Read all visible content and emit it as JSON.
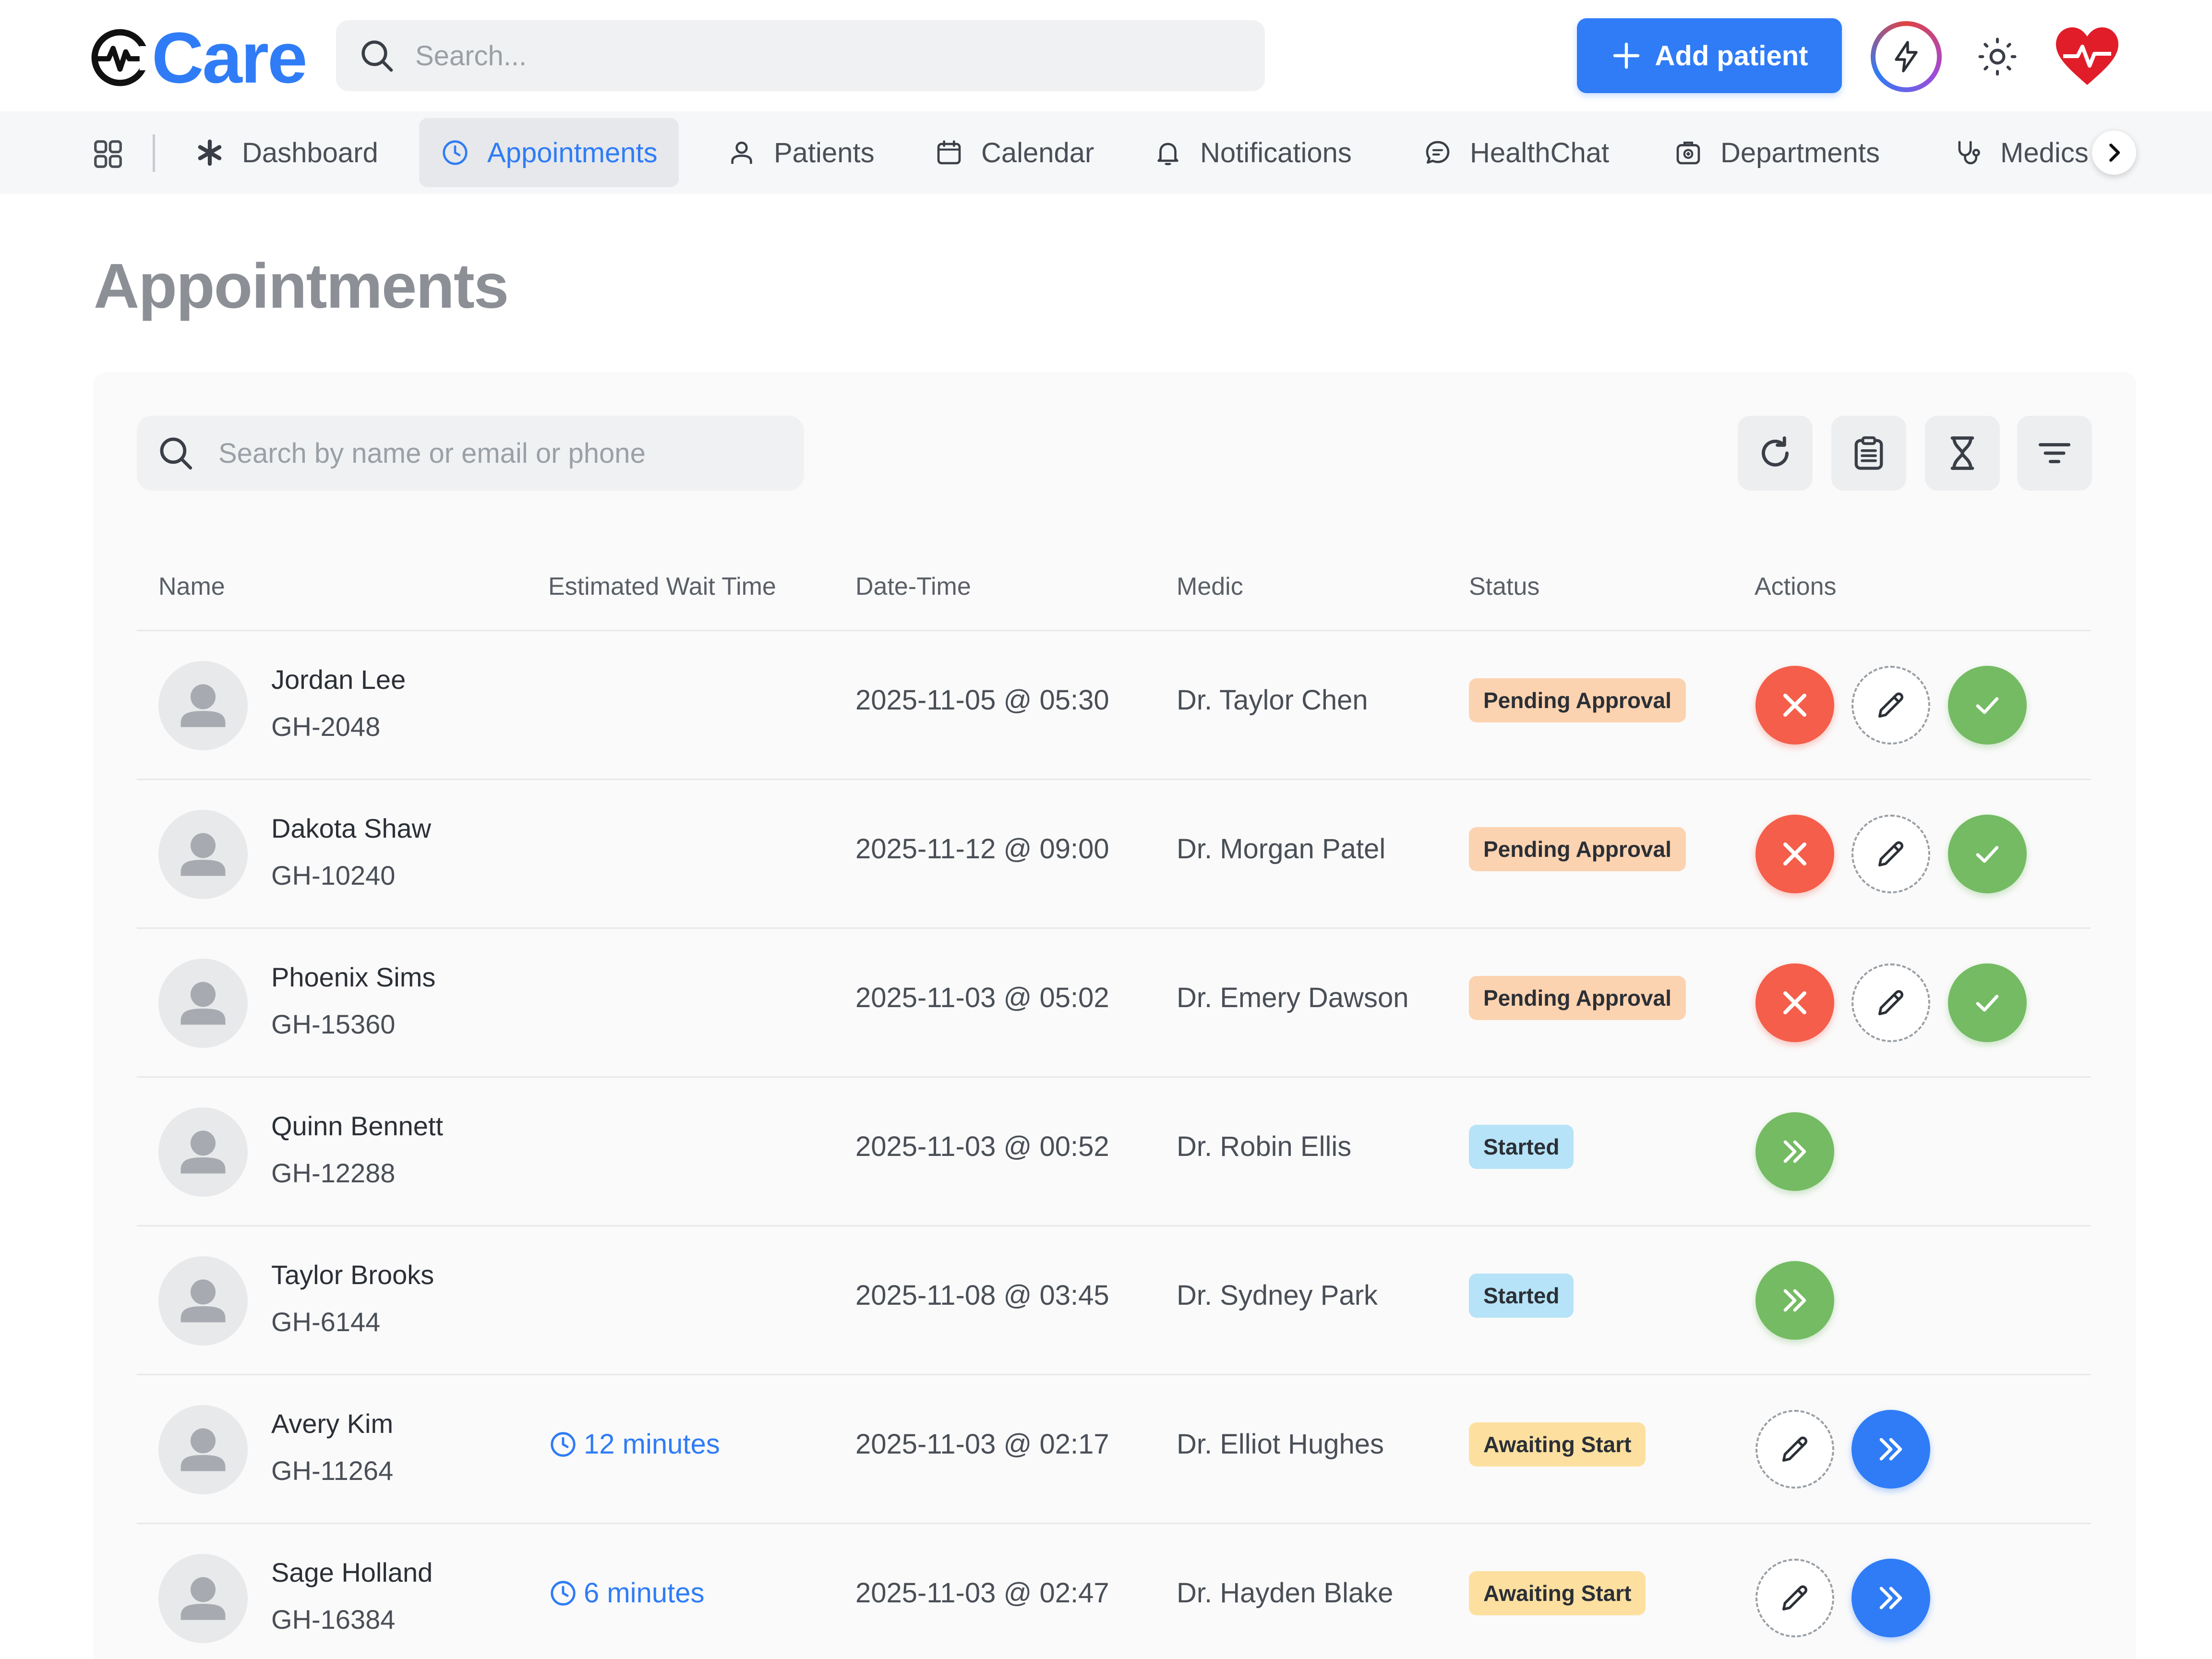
{
  "brand": {
    "name": "Care",
    "accent": "#2f7cf6",
    "logo_icon": "heartbeat-logo-icon"
  },
  "header": {
    "search_placeholder": "Search...",
    "add_patient_label": "Add patient",
    "icons": [
      "search-icon",
      "plus-icon",
      "lightning-icon",
      "sun-icon",
      "heart-pulse-icon"
    ]
  },
  "nav": {
    "items": [
      {
        "label": "Dashboard",
        "icon": "asterisk-icon"
      },
      {
        "label": "Appointments",
        "icon": "clock-icon",
        "active": true
      },
      {
        "label": "Patients",
        "icon": "user-icon"
      },
      {
        "label": "Calendar",
        "icon": "calendar-icon"
      },
      {
        "label": "Notifications",
        "icon": "bell-icon"
      },
      {
        "label": "HealthChat",
        "icon": "chat-icon"
      },
      {
        "label": "Departments",
        "icon": "building-icon"
      },
      {
        "label": "Medics",
        "icon": "stethoscope-icon"
      }
    ]
  },
  "page": {
    "title": "Appointments"
  },
  "table_toolbar": {
    "search_placeholder": "Search by name or email or phone",
    "tools": [
      "refresh-icon",
      "clipboard-icon",
      "hourglass-icon",
      "filter-icon"
    ]
  },
  "table": {
    "headers": [
      "Name",
      "Estimated Wait Time",
      "Date-Time",
      "Medic",
      "Status",
      "Actions"
    ],
    "rows": [
      {
        "name": "Jordan Lee",
        "id": "GH-2048",
        "wait": "",
        "datetime": "2025-11-05 @ 05:30",
        "medic": "Dr. Taylor Chen",
        "status": "Pending Approval"
      },
      {
        "name": "Dakota Shaw",
        "id": "GH-10240",
        "wait": "",
        "datetime": "2025-11-12 @ 09:00",
        "medic": "Dr. Morgan Patel",
        "status": "Pending Approval"
      },
      {
        "name": "Phoenix Sims",
        "id": "GH-15360",
        "wait": "",
        "datetime": "2025-11-03 @ 05:02",
        "medic": "Dr. Emery Dawson",
        "status": "Pending Approval"
      },
      {
        "name": "Quinn Bennett",
        "id": "GH-12288",
        "wait": "",
        "datetime": "2025-11-03 @ 00:52",
        "medic": "Dr. Robin Ellis",
        "status": "Started"
      },
      {
        "name": "Taylor Brooks",
        "id": "GH-6144",
        "wait": "",
        "datetime": "2025-11-08 @ 03:45",
        "medic": "Dr. Sydney Park",
        "status": "Started"
      },
      {
        "name": "Avery Kim",
        "id": "GH-11264",
        "wait": "12 minutes",
        "datetime": "2025-11-03 @ 02:17",
        "medic": "Dr. Elliot Hughes",
        "status": "Awaiting Start"
      },
      {
        "name": "Sage Holland",
        "id": "GH-16384",
        "wait": "6 minutes",
        "datetime": "2025-11-03 @ 02:47",
        "medic": "Dr. Hayden Blake",
        "status": "Awaiting Start"
      }
    ]
  },
  "status_colors": {
    "Pending Approval": "#fcd3b0",
    "Started": "#b6e3f7",
    "Awaiting Start": "#fde0a0"
  }
}
